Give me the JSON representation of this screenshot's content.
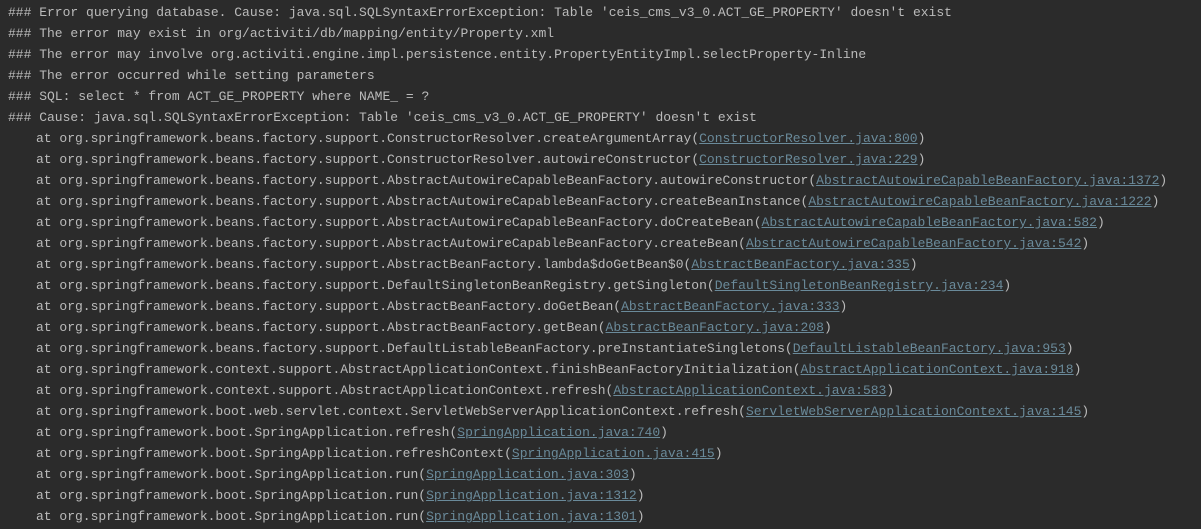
{
  "header": [
    "### Error querying database.  Cause: java.sql.SQLSyntaxErrorException: Table 'ceis_cms_v3_0.ACT_GE_PROPERTY' doesn't exist",
    "### The error may exist in org/activiti/db/mapping/entity/Property.xml",
    "### The error may involve org.activiti.engine.impl.persistence.entity.PropertyEntityImpl.selectProperty-Inline",
    "### The error occurred while setting parameters",
    "### SQL: select * from ACT_GE_PROPERTY where NAME_ = ?",
    "### Cause: java.sql.SQLSyntaxErrorException: Table 'ceis_cms_v3_0.ACT_GE_PROPERTY' doesn't exist"
  ],
  "frames": [
    {
      "method": "at org.springframework.beans.factory.support.ConstructorResolver.createArgumentArray",
      "source": "ConstructorResolver.java:800"
    },
    {
      "method": "at org.springframework.beans.factory.support.ConstructorResolver.autowireConstructor",
      "source": "ConstructorResolver.java:229"
    },
    {
      "method": "at org.springframework.beans.factory.support.AbstractAutowireCapableBeanFactory.autowireConstructor",
      "source": "AbstractAutowireCapableBeanFactory.java:1372"
    },
    {
      "method": "at org.springframework.beans.factory.support.AbstractAutowireCapableBeanFactory.createBeanInstance",
      "source": "AbstractAutowireCapableBeanFactory.java:1222"
    },
    {
      "method": "at org.springframework.beans.factory.support.AbstractAutowireCapableBeanFactory.doCreateBean",
      "source": "AbstractAutowireCapableBeanFactory.java:582"
    },
    {
      "method": "at org.springframework.beans.factory.support.AbstractAutowireCapableBeanFactory.createBean",
      "source": "AbstractAutowireCapableBeanFactory.java:542"
    },
    {
      "method": "at org.springframework.beans.factory.support.AbstractBeanFactory.lambda$doGetBean$0",
      "source": "AbstractBeanFactory.java:335"
    },
    {
      "method": "at org.springframework.beans.factory.support.DefaultSingletonBeanRegistry.getSingleton",
      "source": "DefaultSingletonBeanRegistry.java:234"
    },
    {
      "method": "at org.springframework.beans.factory.support.AbstractBeanFactory.doGetBean",
      "source": "AbstractBeanFactory.java:333"
    },
    {
      "method": "at org.springframework.beans.factory.support.AbstractBeanFactory.getBean",
      "source": "AbstractBeanFactory.java:208"
    },
    {
      "method": "at org.springframework.beans.factory.support.DefaultListableBeanFactory.preInstantiateSingletons",
      "source": "DefaultListableBeanFactory.java:953"
    },
    {
      "method": "at org.springframework.context.support.AbstractApplicationContext.finishBeanFactoryInitialization",
      "source": "AbstractApplicationContext.java:918"
    },
    {
      "method": "at org.springframework.context.support.AbstractApplicationContext.refresh",
      "source": "AbstractApplicationContext.java:583"
    },
    {
      "method": "at org.springframework.boot.web.servlet.context.ServletWebServerApplicationContext.refresh",
      "source": "ServletWebServerApplicationContext.java:145"
    },
    {
      "method": "at org.springframework.boot.SpringApplication.refresh",
      "source": "SpringApplication.java:740"
    },
    {
      "method": "at org.springframework.boot.SpringApplication.refreshContext",
      "source": "SpringApplication.java:415"
    },
    {
      "method": "at org.springframework.boot.SpringApplication.run",
      "source": "SpringApplication.java:303"
    },
    {
      "method": "at org.springframework.boot.SpringApplication.run",
      "source": "SpringApplication.java:1312"
    },
    {
      "method": "at org.springframework.boot.SpringApplication.run",
      "source": "SpringApplication.java:1301"
    }
  ]
}
